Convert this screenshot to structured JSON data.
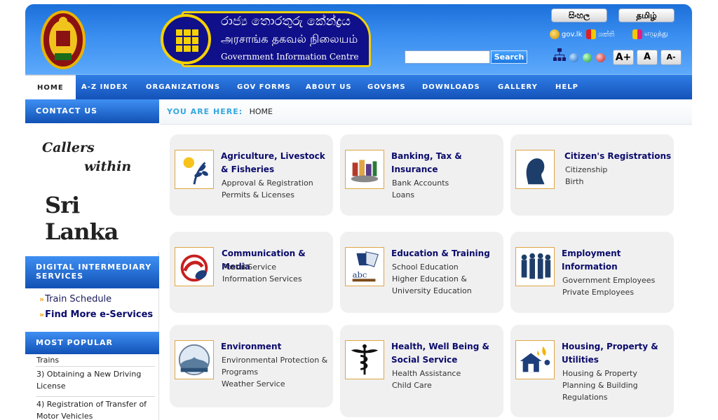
{
  "header": {
    "emblem": "sri-lanka-emblem",
    "logo": {
      "sinhala": "රාජ්‍ය තොරතුරු කේන්ද්‍රය",
      "tamil": "அரசாங்க தகவல் நிலையம்",
      "english": "Government Information Centre"
    },
    "languages": [
      "සිංහල",
      "தமிழ்"
    ],
    "mini_links": [
      {
        "label": "gov.lk",
        "icon": "gov-lk-icon"
      },
      {
        "label": "ශක්ති",
        "icon": "sinhala-keyboard-icon"
      },
      {
        "label": "எழுத்து",
        "icon": "tamil-keyboard-icon"
      }
    ],
    "search": {
      "value": "",
      "button": "Search"
    },
    "font_sizes": [
      "A+",
      "A",
      "A-"
    ],
    "colors": {
      "bar_top": "#1b6fd9",
      "bar_bottom": "#5da9fb",
      "logo_bg": "#10108a",
      "logo_accent": "#f5d100"
    }
  },
  "nav": {
    "items": [
      "HOME",
      "A-Z INDEX",
      "ORGANIZATIONS",
      "GOV FORMS",
      "ABOUT US",
      "GOVSMS",
      "DOWNLOADS",
      "GALLERY",
      "HELP"
    ],
    "active": "HOME"
  },
  "sidebar": {
    "contact_heading": "CONTACT US",
    "callers": [
      "Callers",
      "within",
      "Sri Lanka"
    ],
    "digital_heading": "DIGITAL INTERMEDIARY SERVICES",
    "links": [
      "Train Schedule",
      "Find More e-Services"
    ],
    "popular_heading": "MOST POPULAR",
    "popular": [
      "Trains",
      "3) Obtaining a New Driving License",
      "4) Registration of Transfer of Motor Vehicles"
    ]
  },
  "main": {
    "breadcrumb": {
      "label": "YOU ARE HERE:",
      "value": "HOME"
    },
    "cards": [
      {
        "title": "Agriculture, Livestock & Fisheries",
        "links": [
          "Approval & Registration",
          "Permits & Licenses"
        ],
        "icon": "agriculture-icon"
      },
      {
        "title": "Banking, Tax & Insurance",
        "links": [
          "Bank Accounts",
          "Loans"
        ],
        "icon": "banking-icon"
      },
      {
        "title": "Citizen's Registrations",
        "links": [
          "Citizenship",
          "Birth"
        ],
        "icon": "citizen-icon"
      },
      {
        "title": "Communication & Media",
        "links": [
          "Postal Service",
          "Information Services"
        ],
        "icon": "communication-icon"
      },
      {
        "title": "Education & Training",
        "links": [
          "School Education",
          "Higher Education & University Education"
        ],
        "icon": "education-icon"
      },
      {
        "title": "Employment Information",
        "links": [
          "Government Employees",
          "Private Employees"
        ],
        "icon": "employment-icon"
      },
      {
        "title": "Environment",
        "links": [
          "Environmental Protection & Programs",
          "Weather Service"
        ],
        "icon": "environment-icon"
      },
      {
        "title": "Health, Well Being & Social Service",
        "links": [
          "Health Assistance",
          "Child Care"
        ],
        "icon": "health-icon"
      },
      {
        "title": "Housing, Property & Utilities",
        "links": [
          "Housing & Property",
          "Planning & Building Regulations"
        ],
        "icon": "housing-icon"
      }
    ]
  }
}
